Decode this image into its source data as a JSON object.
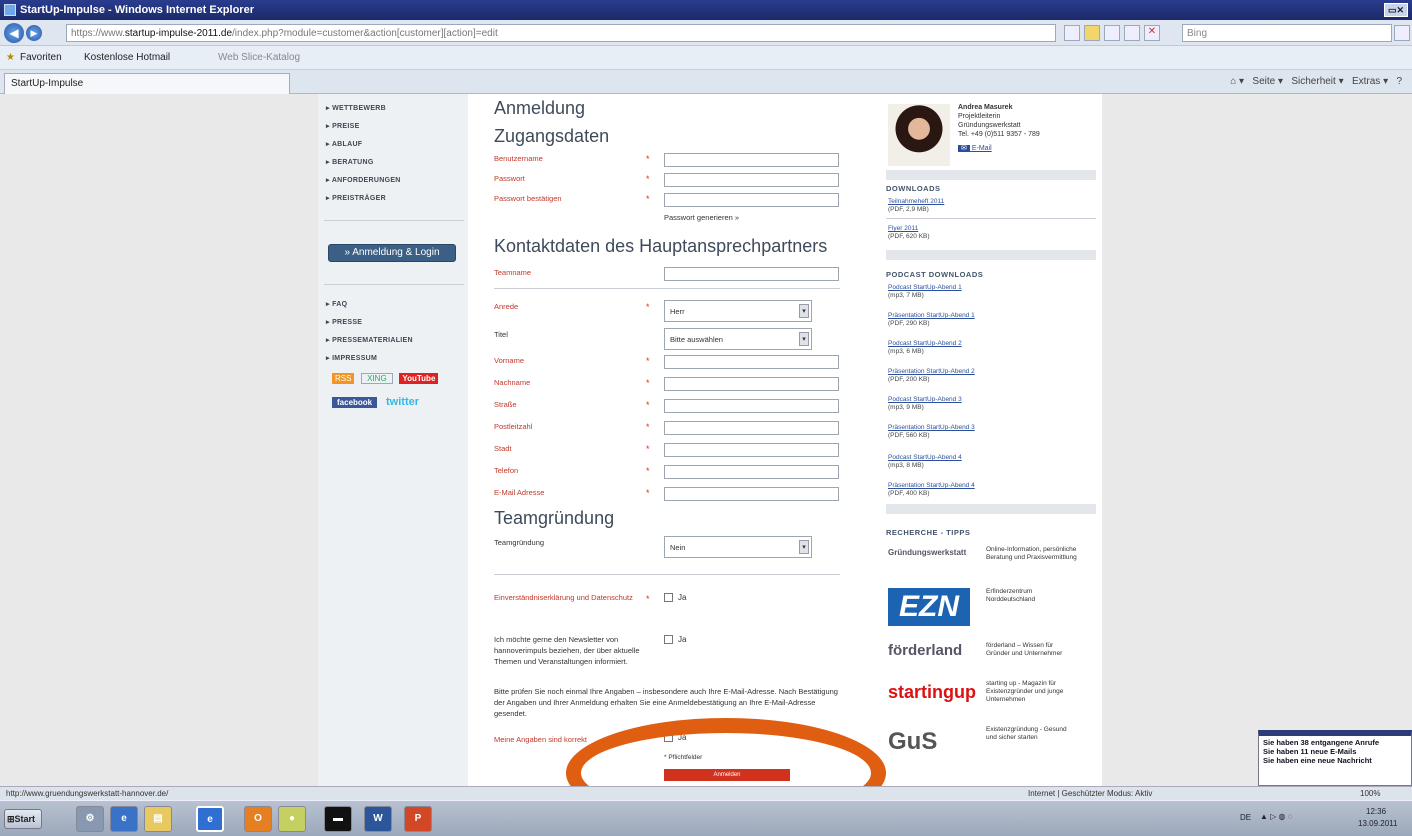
{
  "window": {
    "title": "StartUp-Impulse - Windows Internet Explorer"
  },
  "address": {
    "url_prefix": "https://www.",
    "url_domain": "startup-impulse-2011.de",
    "url_rest": "/index.php?module=customer&action[customer][action]=edit",
    "search_placeholder": "Bing"
  },
  "favorites": {
    "label": "Favoriten",
    "items": [
      "Kostenlose Hotmail",
      "Web Slice-Katalog"
    ]
  },
  "tab": {
    "label": "StartUp-Impulse"
  },
  "commandbar": {
    "items": [
      "Seite",
      "Sicherheit",
      "Extras"
    ]
  },
  "leftnav": {
    "top_items": [
      "WETTBEWERB",
      "PREISE",
      "ABLAUF",
      "BERATUNG",
      "ANFORDERUNGEN",
      "PREISTRÄGER"
    ],
    "login_button": "» Anmeldung & Login",
    "bottom_items": [
      "FAQ",
      "PRESSE",
      "PRESSEMATERIALIEN",
      "IMPRESSUM"
    ],
    "social": [
      "RSS",
      "XING",
      "YouTube",
      "facebook",
      "twitter"
    ]
  },
  "form": {
    "title": "Anmeldung",
    "section_access": "Zugangsdaten",
    "fields_access": [
      "Benutzername",
      "Passwort",
      "Passwort bestätigen"
    ],
    "generate_password": "Passwort generieren »",
    "section_contact": "Kontaktdaten des Hauptansprechpartners",
    "teamname": "Teamname",
    "anrede_label": "Anrede",
    "anrede_value": "Herr",
    "titel_label": "Titel",
    "titel_value": "Bitte auswählen",
    "fields_contact": [
      "Vorname",
      "Nachname",
      "Straße",
      "Postleitzahl",
      "Stadt",
      "Telefon",
      "E-Mail Adresse"
    ],
    "section_team": "Teamgründung",
    "team_label": "Teamgründung",
    "team_value": "Nein",
    "consent_label": "Einverständniserklärung und Datenschutz",
    "newsletter_label": "Ich möchte gerne den Newsletter von hannoverimpuls beziehen, der über aktuelle Themen und Veranstaltungen informiert.",
    "checkbox_label": "Ja",
    "check_text": "Bitte prüfen Sie noch einmal Ihre Angaben – insbesondere auch Ihre E-Mail-Adresse. Nach Bestätigung der Angaben und Ihrer Anmeldung erhalten Sie eine Anmeldebestätigung an Ihre E-Mail-Adresse gesendet.",
    "correct_label": "Meine Angaben sind korrekt",
    "required_note": "* Pflichtfelder",
    "submit": "Anmelden"
  },
  "contact": {
    "name": "Andrea Masurek",
    "role": "Projektleiterin",
    "org": "Gründungswerkstatt",
    "phone": "Tel. +49 (0)511 9357 - 789",
    "email_label": "E-Mail"
  },
  "downloads": {
    "heading": "DOWNLOADS",
    "items": [
      {
        "title": "Teilnahmeheft 2011",
        "meta": "(PDF, 2,9 MB)"
      },
      {
        "title": "Flyer 2011",
        "meta": "(PDF, 620 KB)"
      }
    ]
  },
  "podcasts": {
    "heading": "PODCAST DOWNLOADS",
    "items": [
      {
        "title": "Podcast StartUp-Abend 1",
        "meta": "(mp3, 7 MB)"
      },
      {
        "title": "Präsentation StartUp-Abend 1",
        "meta": "(PDF, 290 KB)"
      },
      {
        "title": "Podcast StartUp-Abend 2",
        "meta": "(mp3, 6 MB)"
      },
      {
        "title": "Präsentation StartUp-Abend 2",
        "meta": "(PDF, 200 KB)"
      },
      {
        "title": "Podcast StartUp-Abend 3",
        "meta": "(mp3, 9 MB)"
      },
      {
        "title": "Präsentation StartUp-Abend 3",
        "meta": "(PDF, 560 KB)"
      },
      {
        "title": "Podcast StartUp-Abend 4",
        "meta": "(mp3, 8 MB)"
      },
      {
        "title": "Präsentation StartUp-Abend 4",
        "meta": "(PDF, 400 KB)"
      }
    ]
  },
  "research": {
    "heading": "RECHERCHE - TIPPS",
    "items": [
      {
        "logo": "Gründungswerkstatt",
        "desc": "Online-Information, persönliche Beratung und Praxisvermittlung"
      },
      {
        "logo": "EZN",
        "desc": "Erfinderzentrum Norddeutschland"
      },
      {
        "logo": "förderland",
        "desc": "förderland – Wissen für Gründer und Unternehmer"
      },
      {
        "logo": "startingup",
        "desc": "starting up - Magazin für Existenzgründer und junge Unternehmen"
      },
      {
        "logo": "GuS",
        "desc": "Existenzgründung - Gesund und sicher starten"
      }
    ]
  },
  "status": {
    "url": "http://www.gruendungswerkstatt-hannover.de/",
    "zone": "Internet | Geschützter Modus: Aktiv",
    "zoom": "100%"
  },
  "taskbar": {
    "start": "Start",
    "lang": "DE",
    "time": "12:36",
    "date": "13.09.2011"
  },
  "notification": {
    "lines": [
      "Sie haben 38 entgangene Anrufe",
      "Sie haben 11 neue E-Mails",
      "Sie haben eine neue Nachricht"
    ]
  },
  "colors": {
    "accent_red": "#c0392b",
    "login_blue": "#3b5f85",
    "annotation_orange": "#e05e12",
    "submit_red": "#d0321e"
  }
}
